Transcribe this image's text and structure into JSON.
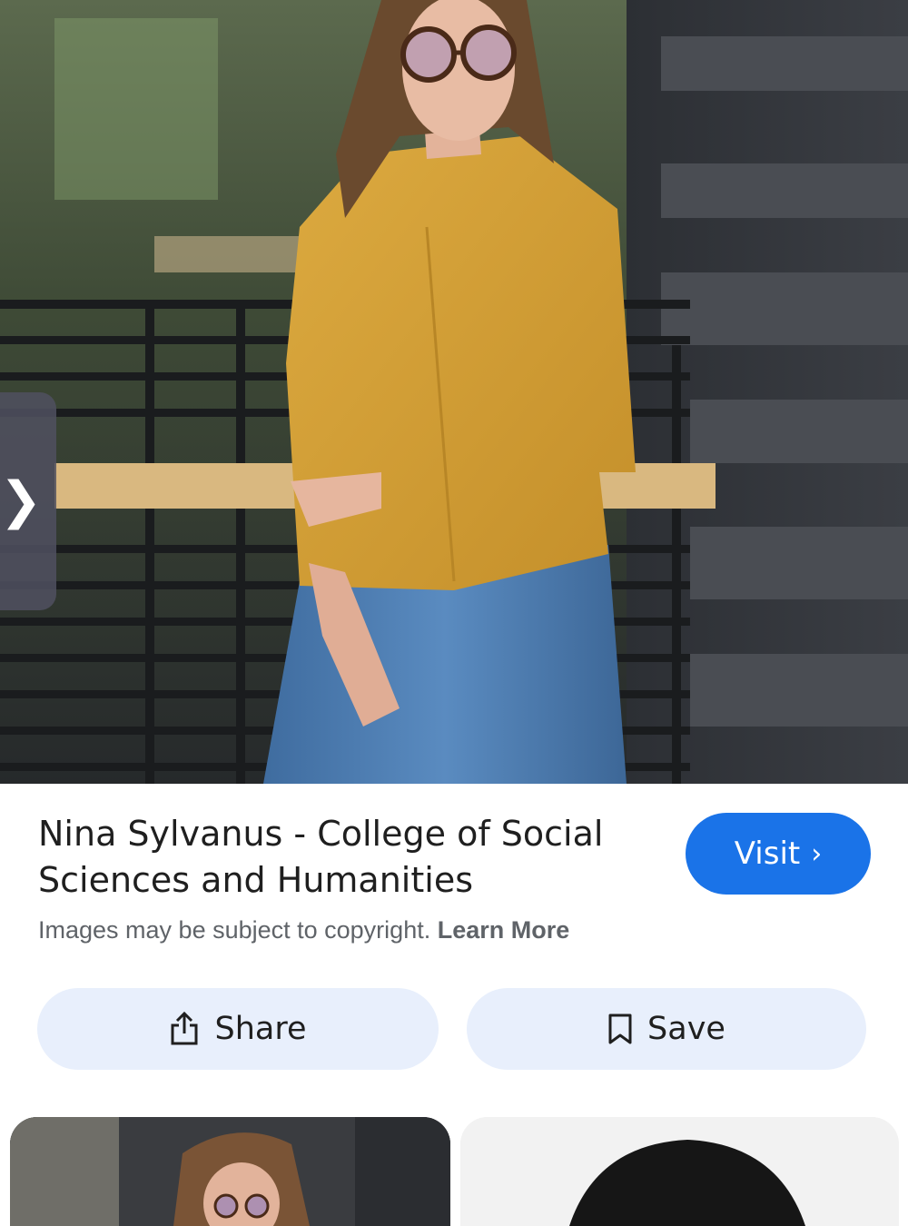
{
  "hero": {
    "image": "woman-in-yellow-jacket-photo",
    "prev_icon": "chevron-right-icon",
    "prev_glyph": "❯"
  },
  "result": {
    "title": "Nina Sylvanus - College of Social Sciences and Humanities",
    "visit_label": "Visit",
    "visit_glyph": "›",
    "copyright_text": "Images may be subject to copyright.",
    "learn_more_label": "Learn More"
  },
  "actions": {
    "share_label": "Share",
    "share_icon": "share-icon",
    "save_label": "Save",
    "save_icon": "bookmark-icon"
  },
  "related": [
    {
      "image": "woman-with-glasses-thumbnail"
    },
    {
      "image": "black-and-white-portrait-thumbnail"
    }
  ],
  "colors": {
    "visit_button": "#1a73e8",
    "action_button": "#e8effc",
    "jacket": "#d9a53a",
    "jeans": "#4f7fb4"
  }
}
